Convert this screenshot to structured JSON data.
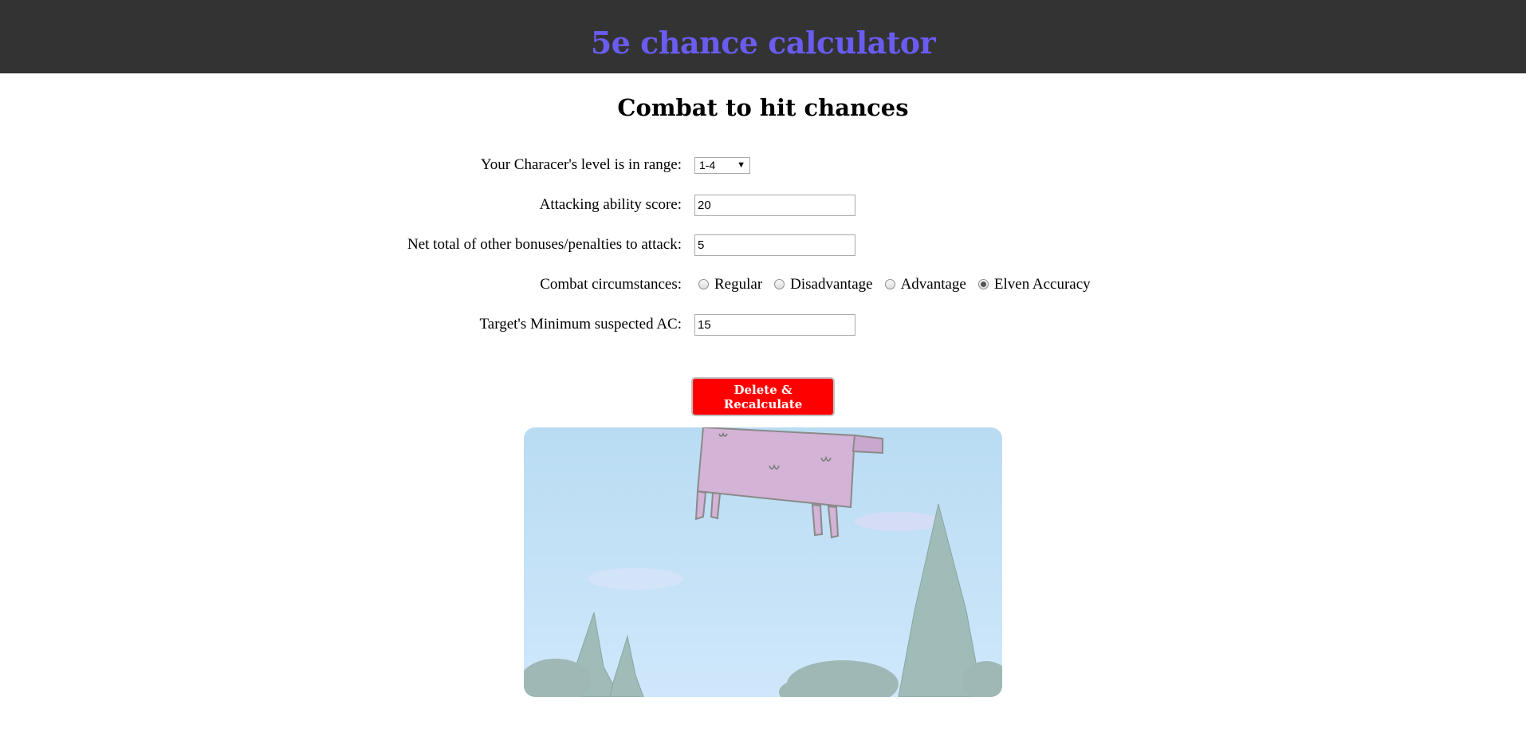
{
  "header": {
    "title": "5e chance calculator"
  },
  "main": {
    "title": "Combat to hit chances",
    "level": {
      "label": "Your Characer's level is in range:",
      "value": "1-4"
    },
    "ability": {
      "label": "Attacking ability score:",
      "value": "20"
    },
    "bonus": {
      "label": "Net total of other bonuses/penalties to attack:",
      "value": "5"
    },
    "circumstances": {
      "label": "Combat circumstances:",
      "options": [
        "Regular",
        "Disadvantage",
        "Advantage",
        "Elven Accuracy"
      ],
      "selected": "Elven Accuracy"
    },
    "ac": {
      "label": "Target's Minimum suspected AC:",
      "value": "15"
    },
    "button_label": "Delete & Recalculate"
  },
  "colors": {
    "header_bg": "#333333",
    "title": "#6a5cf0",
    "button": "#ff0000"
  },
  "illustration": {
    "icon": "flying-cow-icon"
  }
}
